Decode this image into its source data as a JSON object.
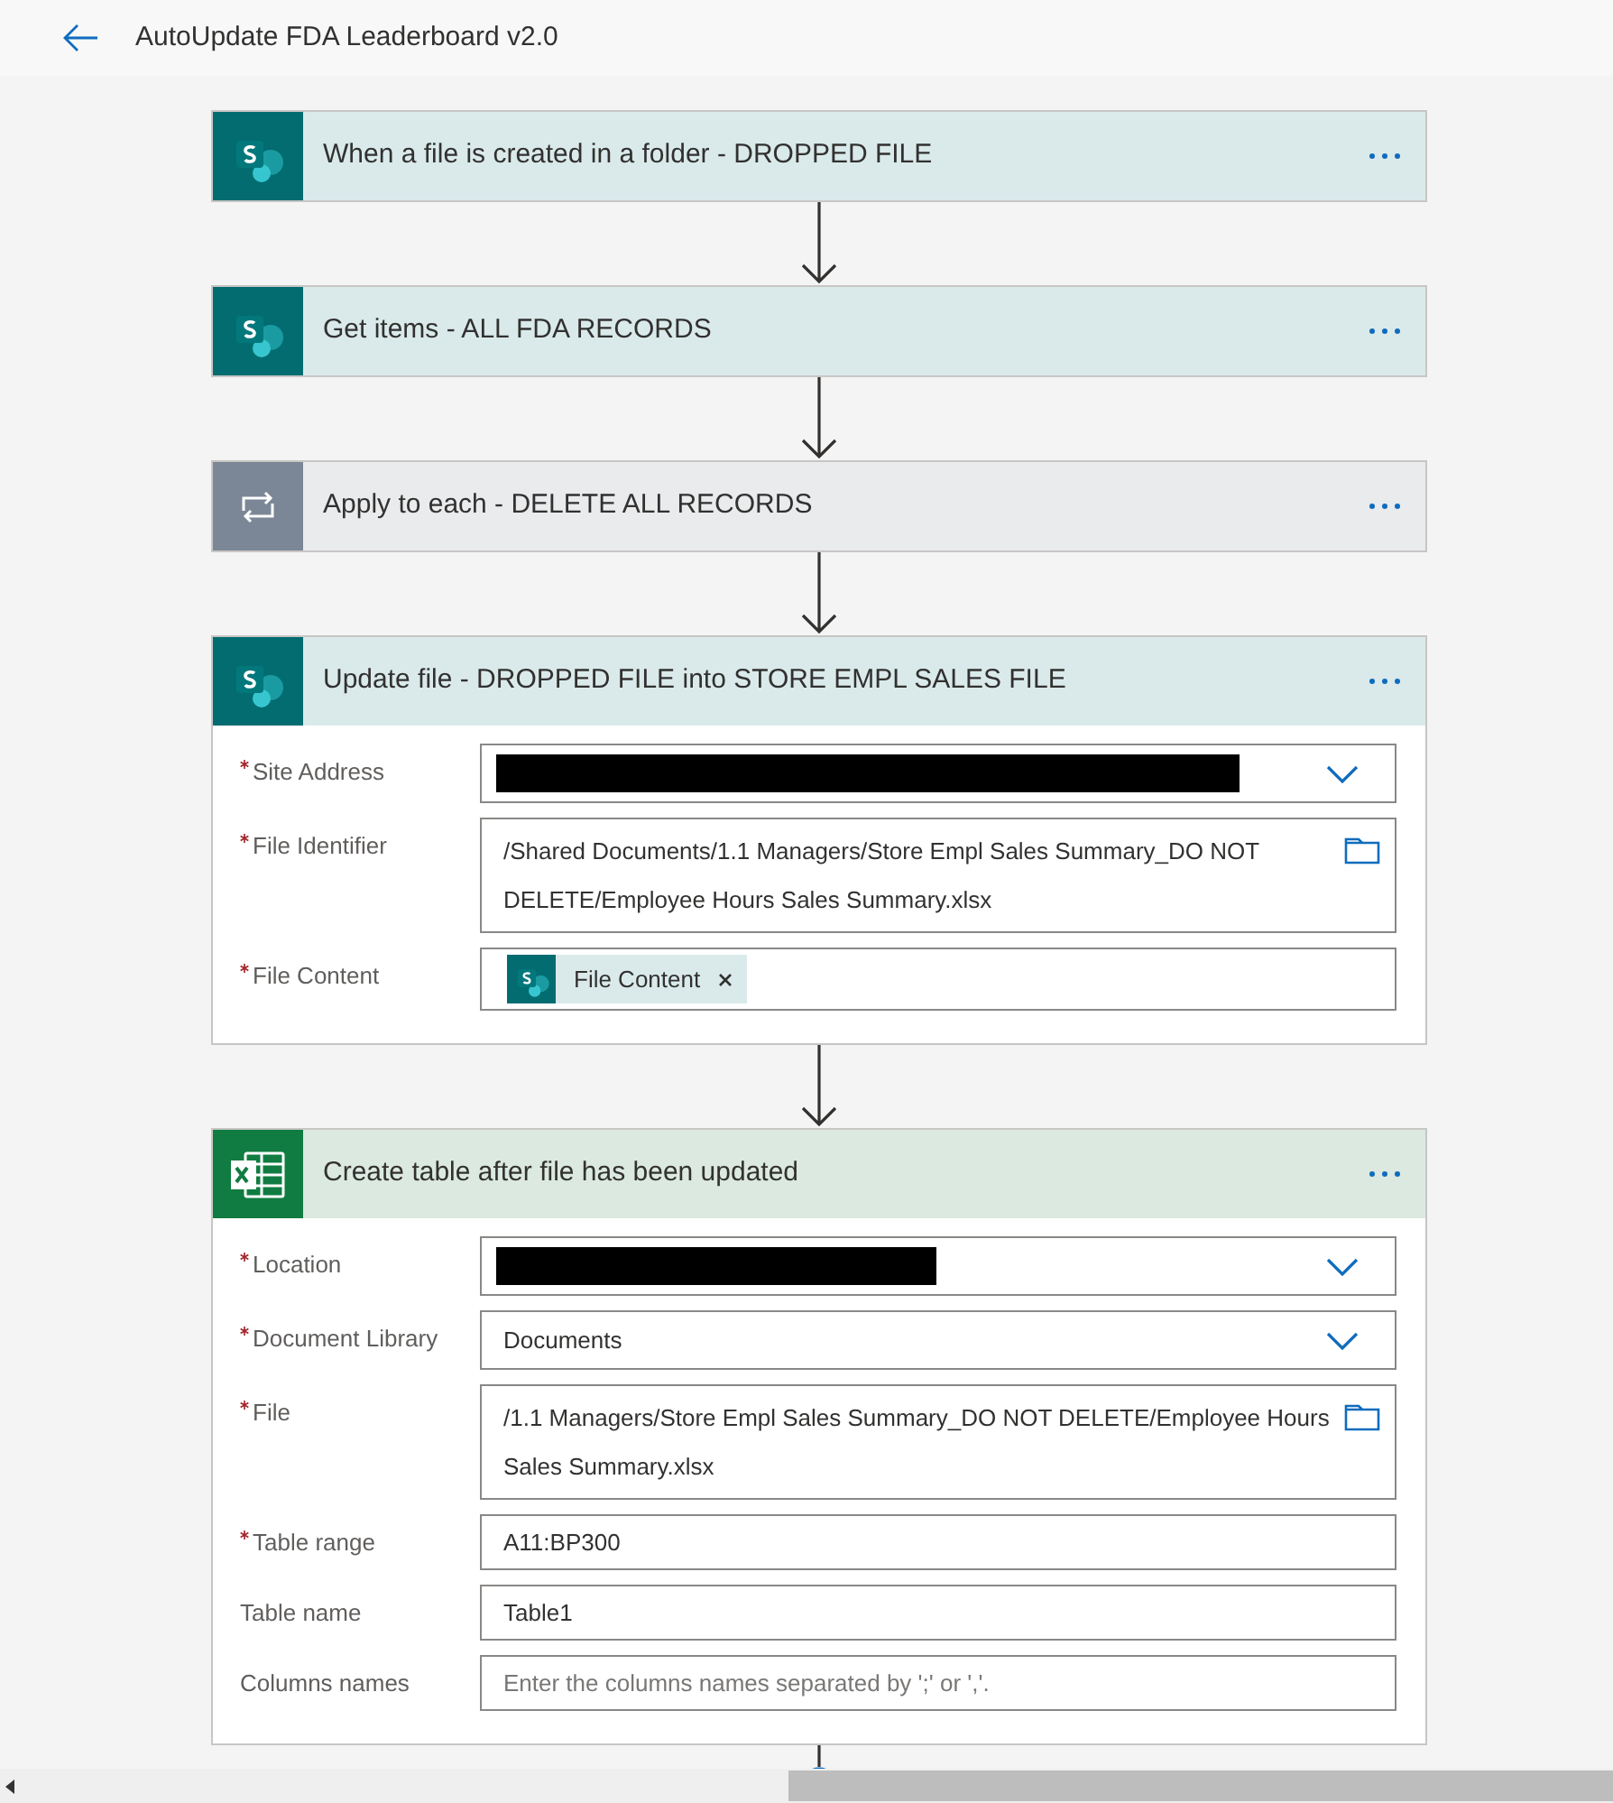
{
  "header": {
    "title": "AutoUpdate FDA Leaderboard v2.0"
  },
  "steps": [
    {
      "kind": "sharepoint",
      "title": "When a file is created in a folder - DROPPED FILE"
    },
    {
      "kind": "sharepoint",
      "title": "Get items - ALL FDA RECORDS"
    },
    {
      "kind": "loop",
      "title": "Apply to each - DELETE ALL RECORDS"
    },
    {
      "kind": "sharepoint",
      "title": "Update file - DROPPED FILE into STORE EMPL SALES FILE",
      "fields": [
        {
          "kind": "dropdown",
          "label": "Site Address",
          "required": true,
          "redacted": true
        },
        {
          "kind": "file",
          "label": "File Identifier",
          "required": true,
          "value": "/Shared Documents/1.1 Managers/Store Empl Sales Summary_DO NOT DELETE/Employee Hours Sales Summary.xlsx"
        },
        {
          "kind": "token",
          "label": "File Content",
          "required": true,
          "value": "File Content"
        }
      ]
    },
    {
      "kind": "excel",
      "title": "Create table after file has been updated",
      "fields": [
        {
          "kind": "dropdown",
          "label": "Location",
          "required": true,
          "redacted": true
        },
        {
          "kind": "dropdown",
          "label": "Document Library",
          "required": true,
          "value": "Documents"
        },
        {
          "kind": "file",
          "label": "File",
          "required": true,
          "value": "/1.1 Managers/Store Empl Sales Summary_DO NOT DELETE/Employee Hours Sales Summary.xlsx"
        },
        {
          "kind": "text",
          "label": "Table range",
          "required": true,
          "value": "A11:BP300"
        },
        {
          "kind": "text",
          "label": "Table name",
          "required": false,
          "value": "Table1"
        },
        {
          "kind": "text",
          "label": "Columns names",
          "required": false,
          "placeholder": "Enter the columns names separated by ';' or ','."
        }
      ]
    }
  ]
}
